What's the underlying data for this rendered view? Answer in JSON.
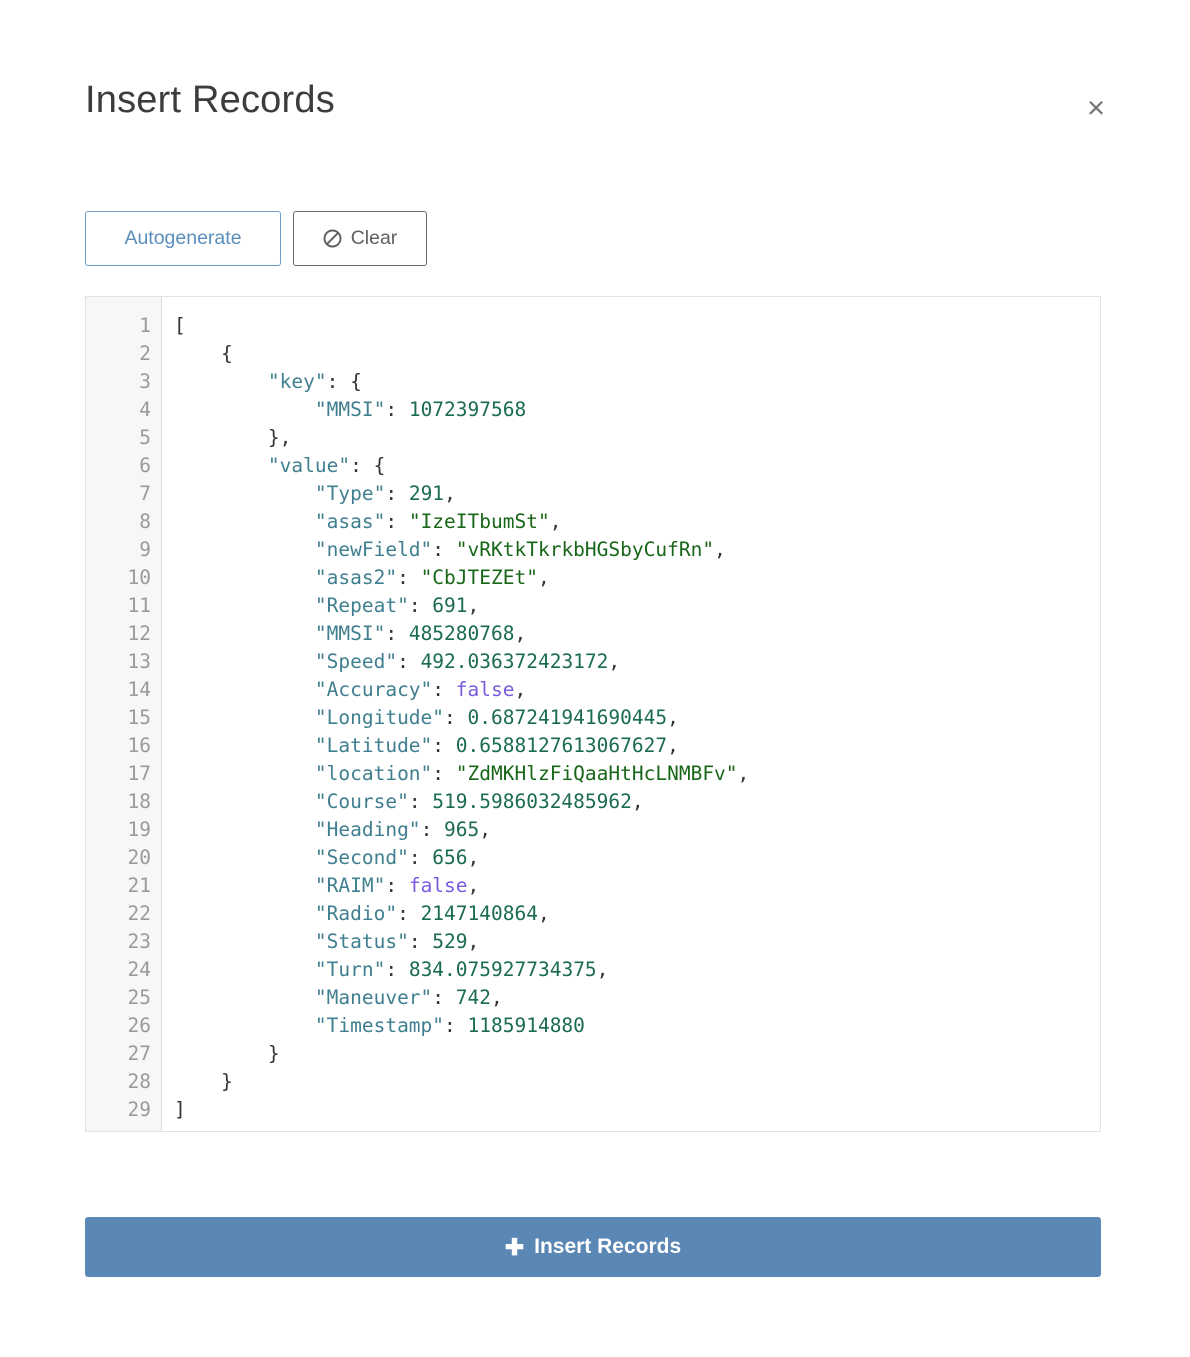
{
  "header": {
    "title": "Insert Records",
    "close_label": "×"
  },
  "toolbar": {
    "autogenerate_label": "Autogenerate",
    "clear_label": "Clear",
    "clear_icon": "ban-icon"
  },
  "editor": {
    "line_count": 29,
    "line_numbers": [
      "1",
      "2",
      "3",
      "4",
      "5",
      "6",
      "7",
      "8",
      "9",
      "10",
      "11",
      "12",
      "13",
      "14",
      "15",
      "16",
      "17",
      "18",
      "19",
      "20",
      "21",
      "22",
      "23",
      "24",
      "25",
      "26",
      "27",
      "28",
      "29"
    ],
    "lines": [
      [
        {
          "t": "[",
          "c": "punct"
        }
      ],
      [
        {
          "t": "    {",
          "c": "punct"
        }
      ],
      [
        {
          "t": "        ",
          "c": "punct"
        },
        {
          "t": "\"key\"",
          "c": "key"
        },
        {
          "t": ": {",
          "c": "punct"
        }
      ],
      [
        {
          "t": "            ",
          "c": "punct"
        },
        {
          "t": "\"MMSI\"",
          "c": "key"
        },
        {
          "t": ": ",
          "c": "punct"
        },
        {
          "t": "1072397568",
          "c": "num"
        }
      ],
      [
        {
          "t": "        },",
          "c": "punct"
        }
      ],
      [
        {
          "t": "        ",
          "c": "punct"
        },
        {
          "t": "\"value\"",
          "c": "key"
        },
        {
          "t": ": {",
          "c": "punct"
        }
      ],
      [
        {
          "t": "            ",
          "c": "punct"
        },
        {
          "t": "\"Type\"",
          "c": "key"
        },
        {
          "t": ": ",
          "c": "punct"
        },
        {
          "t": "291",
          "c": "num"
        },
        {
          "t": ",",
          "c": "punct"
        }
      ],
      [
        {
          "t": "            ",
          "c": "punct"
        },
        {
          "t": "\"asas\"",
          "c": "key"
        },
        {
          "t": ": ",
          "c": "punct"
        },
        {
          "t": "\"IzeITbumSt\"",
          "c": "str"
        },
        {
          "t": ",",
          "c": "punct"
        }
      ],
      [
        {
          "t": "            ",
          "c": "punct"
        },
        {
          "t": "\"newField\"",
          "c": "key"
        },
        {
          "t": ": ",
          "c": "punct"
        },
        {
          "t": "\"vRKtkTkrkbHGSbyCufRn\"",
          "c": "str"
        },
        {
          "t": ",",
          "c": "punct"
        }
      ],
      [
        {
          "t": "            ",
          "c": "punct"
        },
        {
          "t": "\"asas2\"",
          "c": "key"
        },
        {
          "t": ": ",
          "c": "punct"
        },
        {
          "t": "\"CbJTEZEt\"",
          "c": "str"
        },
        {
          "t": ",",
          "c": "punct"
        }
      ],
      [
        {
          "t": "            ",
          "c": "punct"
        },
        {
          "t": "\"Repeat\"",
          "c": "key"
        },
        {
          "t": ": ",
          "c": "punct"
        },
        {
          "t": "691",
          "c": "num"
        },
        {
          "t": ",",
          "c": "punct"
        }
      ],
      [
        {
          "t": "            ",
          "c": "punct"
        },
        {
          "t": "\"MMSI\"",
          "c": "key"
        },
        {
          "t": ": ",
          "c": "punct"
        },
        {
          "t": "485280768",
          "c": "num"
        },
        {
          "t": ",",
          "c": "punct"
        }
      ],
      [
        {
          "t": "            ",
          "c": "punct"
        },
        {
          "t": "\"Speed\"",
          "c": "key"
        },
        {
          "t": ": ",
          "c": "punct"
        },
        {
          "t": "492.036372423172",
          "c": "num"
        },
        {
          "t": ",",
          "c": "punct"
        }
      ],
      [
        {
          "t": "            ",
          "c": "punct"
        },
        {
          "t": "\"Accuracy\"",
          "c": "key"
        },
        {
          "t": ": ",
          "c": "punct"
        },
        {
          "t": "false",
          "c": "bool"
        },
        {
          "t": ",",
          "c": "punct"
        }
      ],
      [
        {
          "t": "            ",
          "c": "punct"
        },
        {
          "t": "\"Longitude\"",
          "c": "key"
        },
        {
          "t": ": ",
          "c": "punct"
        },
        {
          "t": "0.687241941690445",
          "c": "num"
        },
        {
          "t": ",",
          "c": "punct"
        }
      ],
      [
        {
          "t": "            ",
          "c": "punct"
        },
        {
          "t": "\"Latitude\"",
          "c": "key"
        },
        {
          "t": ": ",
          "c": "punct"
        },
        {
          "t": "0.6588127613067627",
          "c": "num"
        },
        {
          "t": ",",
          "c": "punct"
        }
      ],
      [
        {
          "t": "            ",
          "c": "punct"
        },
        {
          "t": "\"location\"",
          "c": "key"
        },
        {
          "t": ": ",
          "c": "punct"
        },
        {
          "t": "\"ZdMKHlzFiQaaHtHcLNMBFv\"",
          "c": "str"
        },
        {
          "t": ",",
          "c": "punct"
        }
      ],
      [
        {
          "t": "            ",
          "c": "punct"
        },
        {
          "t": "\"Course\"",
          "c": "key"
        },
        {
          "t": ": ",
          "c": "punct"
        },
        {
          "t": "519.5986032485962",
          "c": "num"
        },
        {
          "t": ",",
          "c": "punct"
        }
      ],
      [
        {
          "t": "            ",
          "c": "punct"
        },
        {
          "t": "\"Heading\"",
          "c": "key"
        },
        {
          "t": ": ",
          "c": "punct"
        },
        {
          "t": "965",
          "c": "num"
        },
        {
          "t": ",",
          "c": "punct"
        }
      ],
      [
        {
          "t": "            ",
          "c": "punct"
        },
        {
          "t": "\"Second\"",
          "c": "key"
        },
        {
          "t": ": ",
          "c": "punct"
        },
        {
          "t": "656",
          "c": "num"
        },
        {
          "t": ",",
          "c": "punct"
        }
      ],
      [
        {
          "t": "            ",
          "c": "punct"
        },
        {
          "t": "\"RAIM\"",
          "c": "key"
        },
        {
          "t": ": ",
          "c": "punct"
        },
        {
          "t": "false",
          "c": "bool"
        },
        {
          "t": ",",
          "c": "punct"
        }
      ],
      [
        {
          "t": "            ",
          "c": "punct"
        },
        {
          "t": "\"Radio\"",
          "c": "key"
        },
        {
          "t": ": ",
          "c": "punct"
        },
        {
          "t": "2147140864",
          "c": "num"
        },
        {
          "t": ",",
          "c": "punct"
        }
      ],
      [
        {
          "t": "            ",
          "c": "punct"
        },
        {
          "t": "\"Status\"",
          "c": "key"
        },
        {
          "t": ": ",
          "c": "punct"
        },
        {
          "t": "529",
          "c": "num"
        },
        {
          "t": ",",
          "c": "punct"
        }
      ],
      [
        {
          "t": "            ",
          "c": "punct"
        },
        {
          "t": "\"Turn\"",
          "c": "key"
        },
        {
          "t": ": ",
          "c": "punct"
        },
        {
          "t": "834.075927734375",
          "c": "num"
        },
        {
          "t": ",",
          "c": "punct"
        }
      ],
      [
        {
          "t": "            ",
          "c": "punct"
        },
        {
          "t": "\"Maneuver\"",
          "c": "key"
        },
        {
          "t": ": ",
          "c": "punct"
        },
        {
          "t": "742",
          "c": "num"
        },
        {
          "t": ",",
          "c": "punct"
        }
      ],
      [
        {
          "t": "            ",
          "c": "punct"
        },
        {
          "t": "\"Timestamp\"",
          "c": "key"
        },
        {
          "t": ": ",
          "c": "punct"
        },
        {
          "t": "1185914880",
          "c": "num"
        }
      ],
      [
        {
          "t": "        }",
          "c": "punct"
        }
      ],
      [
        {
          "t": "    }",
          "c": "punct"
        }
      ],
      [
        {
          "t": "]",
          "c": "punct"
        }
      ]
    ]
  },
  "footer": {
    "submit_label": "Insert Records",
    "submit_icon": "plus-icon"
  },
  "colors": {
    "accent": "#5b87b5",
    "autogenerate_text": "#5b8ebd",
    "json_key": "#3f7f8f",
    "json_string": "#186618",
    "json_number": "#1a6b50",
    "json_boolean": "#7a5be0",
    "gutter_bg": "#f7f7f7",
    "editor_border": "#dfe3e8"
  }
}
